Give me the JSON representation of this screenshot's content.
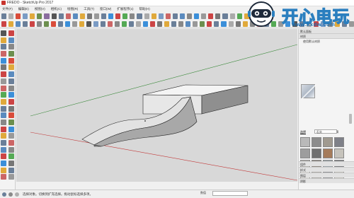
{
  "window": {
    "title": "FREDO - SketchUp Pro 2017"
  },
  "menu": {
    "items": [
      "文件(F)",
      "编辑(E)",
      "视图(V)",
      "相机(C)",
      "绘图(R)",
      "工具(T)",
      "窗口(W)",
      "扩展程序(x)",
      "帮助(H)"
    ]
  },
  "toolbar_row1": {
    "icon_colors": [
      "#6a7f99",
      "#b0b0b0",
      "#d94c3a",
      "#7a9bc4",
      "#e0a93b",
      "#6c8f4e",
      "#8a6d9e",
      "#555",
      "#6a7f99",
      "#c66",
      "#5a8bbf",
      "#e0a93b",
      "#777",
      "#999",
      "#6a7f99",
      "#3b8fd9",
      "#c44",
      "#5a5",
      "#888",
      "#6a7f99",
      "#aaa",
      "#e0a93b",
      "#7a9bc4",
      "#c66",
      "#6a7f99",
      "#5a8bbf",
      "#888",
      "#3b8fd9",
      "#999",
      "#c44",
      "#777",
      "#6a7f99",
      "#aaa",
      "#5a5",
      "#e0a93b"
    ]
  },
  "toolbar_row2": {
    "icon_colors": [
      "#c44",
      "#e0a93b",
      "#5a8bbf",
      "#6a7f99",
      "#c44",
      "#888",
      "#6c8f4e",
      "#d94c3a",
      "#6a7f99",
      "#3b8fd9",
      "#999",
      "#e0a93b",
      "#555",
      "#7a9bc4",
      "#6a7f99",
      "#c66",
      "#888",
      "#5a5",
      "#6a7f99",
      "#aaa",
      "#3b8fd9",
      "#c44",
      "#777",
      "#e0a93b",
      "#6a7f99",
      "#888",
      "#5a8bbf",
      "#999",
      "#6c8f4e",
      "#c44",
      "#6a7f99",
      "#3b8fd9",
      "#aaa",
      "#777",
      "#e0a93b",
      "#888",
      "#c66",
      "#6a7f99",
      "#5a5",
      "#999",
      "#3b8fd9",
      "#555",
      "#6a7f99",
      "#aaa",
      "#c44",
      "#7a9bc4",
      "#888",
      "#e0a93b",
      "#6a7f99",
      "#999"
    ]
  },
  "left_palette": {
    "tool_colors": [
      "#555",
      "#c44",
      "#e0a93b",
      "#5a8bbf",
      "#6a7f99",
      "#888",
      "#c66",
      "#6c8f4e",
      "#3b8fd9",
      "#d94c3a",
      "#777",
      "#e0a93b",
      "#c44",
      "#5a8bbf",
      "#999",
      "#6a7f99",
      "#c66",
      "#888",
      "#5a5",
      "#3b8fd9",
      "#e0a93b",
      "#c44",
      "#6a7f99",
      "#777",
      "#5a8bbf",
      "#d94c3a",
      "#888",
      "#6c8f4e",
      "#c44",
      "#3b8fd9",
      "#e0a93b",
      "#999",
      "#6a7f99",
      "#c66",
      "#5a8bbf",
      "#888",
      "#c44",
      "#5a5",
      "#3b8fd9",
      "#777",
      "#e0a93b",
      "#6a7f99",
      "#c66",
      "#999"
    ]
  },
  "right_panel": {
    "header": "默认面板",
    "section_label": "材质",
    "subtitle": "使用默认材质",
    "tabs": [
      "选择",
      "编辑"
    ],
    "selected_collection": "石头",
    "swatches": [
      "#b9b9b9",
      "#8c8c8c",
      "#a09a90",
      "#7e8088",
      "#9d9d9d",
      "#6f6f6f",
      "#a57b5a",
      "#c6c3bc",
      "#b3b1ad",
      "#8f8a83",
      "#9aa3a8",
      "#7b7d80",
      "#d8d6d2",
      "#a8a6a2",
      "#8d8f92",
      "#bcbab4"
    ],
    "sections": [
      "组件",
      "样式",
      "图层",
      "阴影"
    ]
  },
  "status": {
    "text": "选择对象。切换到扩充选择。拖动鼠标选择多项。",
    "measure_label": "数值"
  },
  "logo": {
    "brand": "开心电玩",
    "url": "www.kxdw.com"
  },
  "colors": {
    "accent": "#2b7fbf",
    "viewport_bg": "#d8d8d8",
    "axis_red": "#c23a3a",
    "axis_green": "#3c8a3c"
  }
}
